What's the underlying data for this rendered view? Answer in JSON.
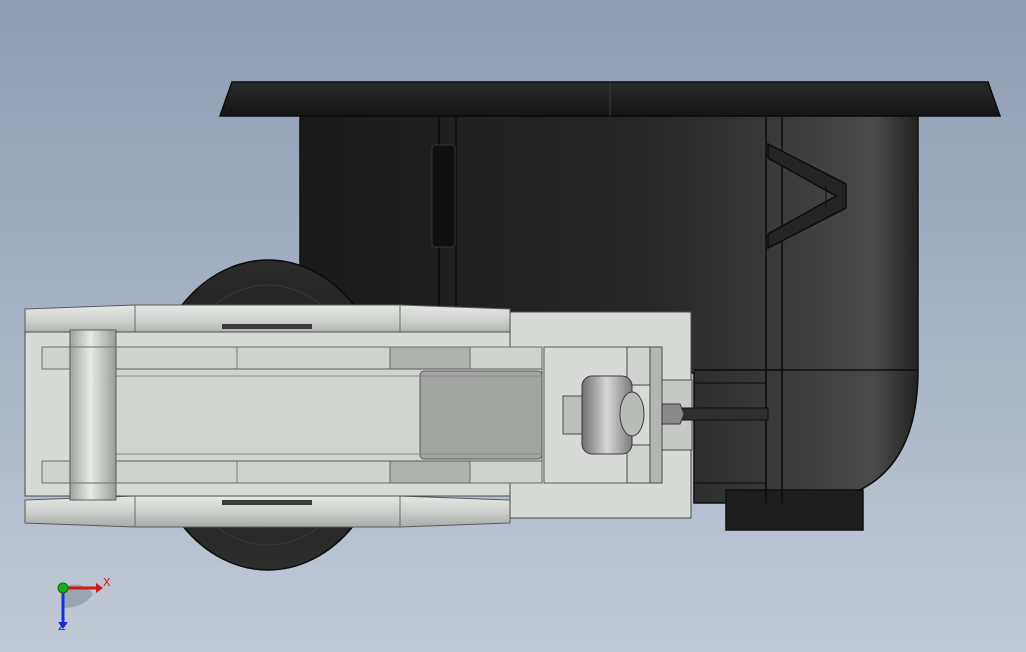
{
  "viewport": {
    "background_top": "#8d9db3",
    "background_bottom": "#c2cad6"
  },
  "model": {
    "parts": [
      "caster-housing",
      "wheel",
      "swivel-fork",
      "axle-pin",
      "brake-clamp"
    ],
    "colors": {
      "housing_dark": "#1c1c1c",
      "housing_mid": "#3a3a3a",
      "fork_light": "#d4d6d4",
      "fork_mid": "#b7b9b7",
      "fork_shadow": "#8e908e",
      "edge": "#101010"
    }
  },
  "triad": {
    "x_label": "X",
    "z_label": "Z",
    "x_color": "#d01818",
    "y_color": "#18b018",
    "z_color": "#1830d0"
  }
}
